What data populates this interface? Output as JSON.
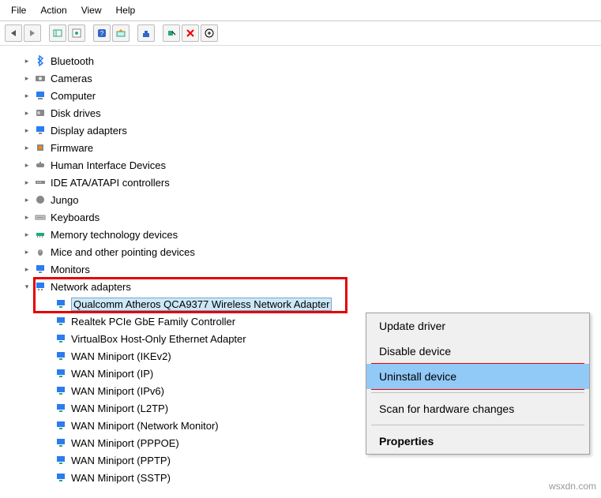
{
  "menubar": [
    "File",
    "Action",
    "View",
    "Help"
  ],
  "tree": {
    "nodes": [
      {
        "label": "Bluetooth",
        "icon": "bt"
      },
      {
        "label": "Cameras",
        "icon": "cam"
      },
      {
        "label": "Computer",
        "icon": "pc"
      },
      {
        "label": "Disk drives",
        "icon": "disk"
      },
      {
        "label": "Display adapters",
        "icon": "disp"
      },
      {
        "label": "Firmware",
        "icon": "fw"
      },
      {
        "label": "Human Interface Devices",
        "icon": "hid"
      },
      {
        "label": "IDE ATA/ATAPI controllers",
        "icon": "ide"
      },
      {
        "label": "Jungo",
        "icon": "jungo"
      },
      {
        "label": "Keyboards",
        "icon": "kb"
      },
      {
        "label": "Memory technology devices",
        "icon": "mem"
      },
      {
        "label": "Mice and other pointing devices",
        "icon": "mouse"
      },
      {
        "label": "Monitors",
        "icon": "mon"
      },
      {
        "label": "Network adapters",
        "icon": "net",
        "expanded": true
      }
    ],
    "network_children": [
      {
        "label": "Qualcomm Atheros QCA9377 Wireless Network Adapter",
        "selected": true
      },
      {
        "label": "Realtek PCIe GbE Family Controller"
      },
      {
        "label": "VirtualBox Host-Only Ethernet Adapter"
      },
      {
        "label": "WAN Miniport (IKEv2)"
      },
      {
        "label": "WAN Miniport (IP)"
      },
      {
        "label": "WAN Miniport (IPv6)"
      },
      {
        "label": "WAN Miniport (L2TP)"
      },
      {
        "label": "WAN Miniport (Network Monitor)"
      },
      {
        "label": "WAN Miniport (PPPOE)"
      },
      {
        "label": "WAN Miniport (PPTP)"
      },
      {
        "label": "WAN Miniport (SSTP)"
      }
    ]
  },
  "context_menu": [
    {
      "label": "Update driver"
    },
    {
      "label": "Disable device"
    },
    {
      "label": "Uninstall device",
      "highlight": true
    },
    {
      "sep": true
    },
    {
      "label": "Scan for hardware changes"
    },
    {
      "sep": true
    },
    {
      "label": "Properties",
      "bold": true
    }
  ],
  "watermark": "wsxdn.com"
}
